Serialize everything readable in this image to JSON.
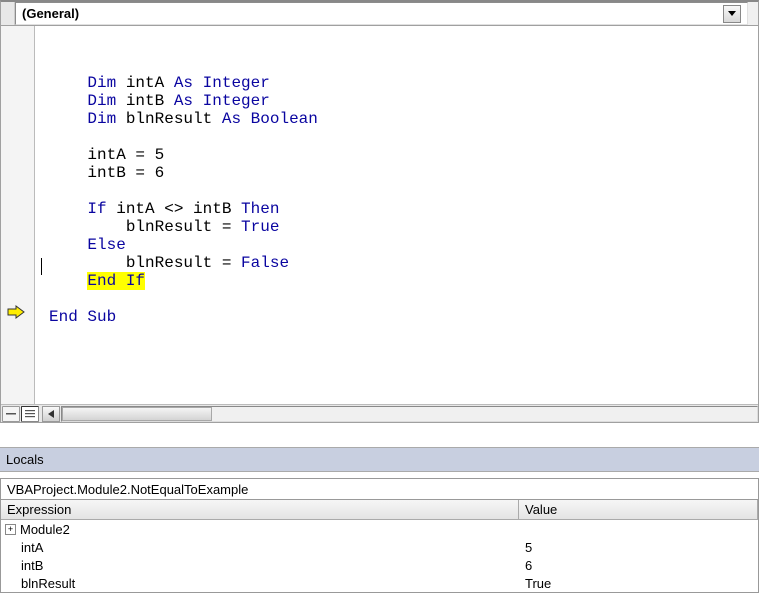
{
  "dropdown": {
    "label": "(General)"
  },
  "code": {
    "ind1": "    ",
    "ind2": "        ",
    "dim": "Dim",
    "as": "As",
    "integer": "Integer",
    "boolean": "Boolean",
    "if": "If",
    "then": "Then",
    "else": "Else",
    "endif": "End If",
    "endsub": "End Sub",
    "true": "True",
    "false": "False",
    "var_a": " intA ",
    "var_b": " intB ",
    "var_res": " blnResult ",
    "line_a5": "    intA = 5",
    "line_b6": "    intB = 6",
    "cmp": " intA <> intB ",
    "res_true": "        blnResult = ",
    "res_false": "        blnResult = "
  },
  "locals": {
    "title": "Locals",
    "context": "VBAProject.Module2.NotEqualToExample",
    "col_expr": "Expression",
    "col_val": "Value",
    "rows": [
      {
        "name": "Module2",
        "value": "",
        "expandable": true
      },
      {
        "name": "intA",
        "value": "5"
      },
      {
        "name": "intB",
        "value": "6"
      },
      {
        "name": "blnResult",
        "value": "True"
      }
    ]
  }
}
